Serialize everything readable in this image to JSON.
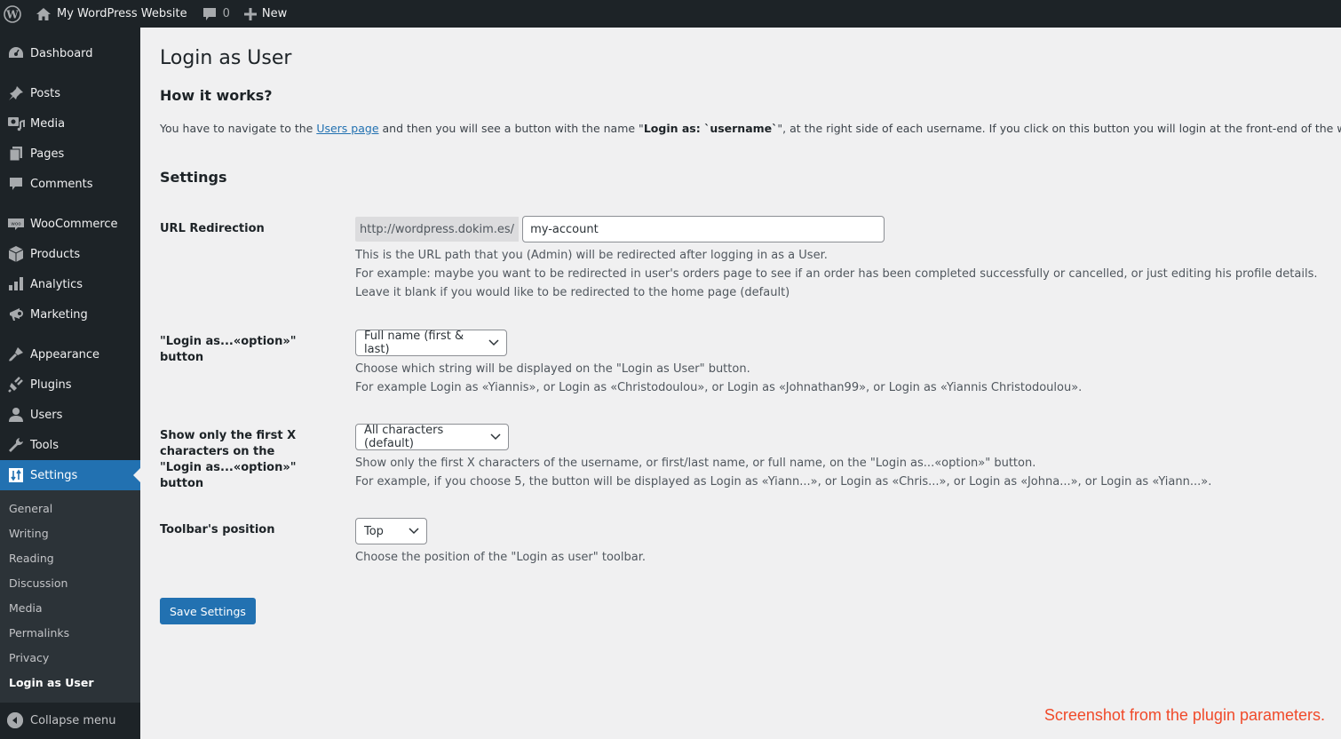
{
  "adminbar": {
    "site_name": "My WordPress Website",
    "comments_count": "0",
    "new_label": "New"
  },
  "sidebar": {
    "items": [
      {
        "label": "Dashboard",
        "icon": "dashboard-icon"
      },
      {
        "label": "Posts",
        "icon": "pin-icon"
      },
      {
        "label": "Media",
        "icon": "media-icon"
      },
      {
        "label": "Pages",
        "icon": "pages-icon"
      },
      {
        "label": "Comments",
        "icon": "comment-icon"
      },
      {
        "label": "WooCommerce",
        "icon": "woocommerce-icon"
      },
      {
        "label": "Products",
        "icon": "box-icon"
      },
      {
        "label": "Analytics",
        "icon": "bar-chart-icon"
      },
      {
        "label": "Marketing",
        "icon": "megaphone-icon"
      },
      {
        "label": "Appearance",
        "icon": "paintbrush-icon"
      },
      {
        "label": "Plugins",
        "icon": "plug-icon"
      },
      {
        "label": "Users",
        "icon": "user-icon"
      },
      {
        "label": "Tools",
        "icon": "wrench-icon"
      },
      {
        "label": "Settings",
        "icon": "settings-icon"
      }
    ],
    "submenu": [
      "General",
      "Writing",
      "Reading",
      "Discussion",
      "Media",
      "Permalinks",
      "Privacy",
      "Login as User"
    ],
    "collapse_label": "Collapse menu"
  },
  "page": {
    "title": "Login as User",
    "how_title": "How it works?",
    "how_text_1": "You have to navigate to the ",
    "how_link": "Users page",
    "how_text_2": " and then you will see a button with the name \"",
    "how_bold": "Login as: `username`",
    "how_text_3": "\", at the right side of each username. If you click on this button you will login at the front-end of the website as this User.",
    "settings_title": "Settings"
  },
  "settings": {
    "url_redirection": {
      "label": "URL Redirection",
      "prefix": "http://wordpress.dokim.es/",
      "value": "my-account",
      "desc": [
        "This is the URL path that you (Admin) will be redirected after logging in as a User.",
        "For example: maybe you want to be redirected in user's orders page to see if an order has been completed successfully or cancelled, or just editing his profile details.",
        "Leave it blank if you would like to be redirected to the home page (default)"
      ]
    },
    "login_as_option": {
      "label": "\"Login as...«option»\" button",
      "selected": "Full name (first & last)",
      "desc": [
        "Choose which string will be displayed on the \"Login as User\" button.",
        "For example Login as «Yiannis», or Login as «Christodoulou», or Login as «Johnathan99», or Login as «Yiannis Christodoulou»."
      ]
    },
    "first_x_chars": {
      "label": "Show only the first X characters on the \"Login as...«option»\" button",
      "selected": "All characters (default)",
      "desc": [
        "Show only the first X characters of the username, or first/last name, or full name, on the \"Login as...«option»\" button.",
        "For example, if you choose 5, the button will be displayed as Login as «Yiann...», or Login as «Chris...», or Login as «Johna...», or Login as «Yiann...»."
      ]
    },
    "toolbar_position": {
      "label": "Toolbar's position",
      "selected": "Top",
      "desc": [
        "Choose the position of the \"Login as user\" toolbar."
      ]
    },
    "save_label": "Save Settings"
  },
  "caption": "Screenshot from the plugin parameters.",
  "colors": {
    "accent": "#2271b1",
    "adminbar_bg": "#1d2327",
    "submenu_bg": "#2c3338",
    "caption": "#f04a2a"
  }
}
